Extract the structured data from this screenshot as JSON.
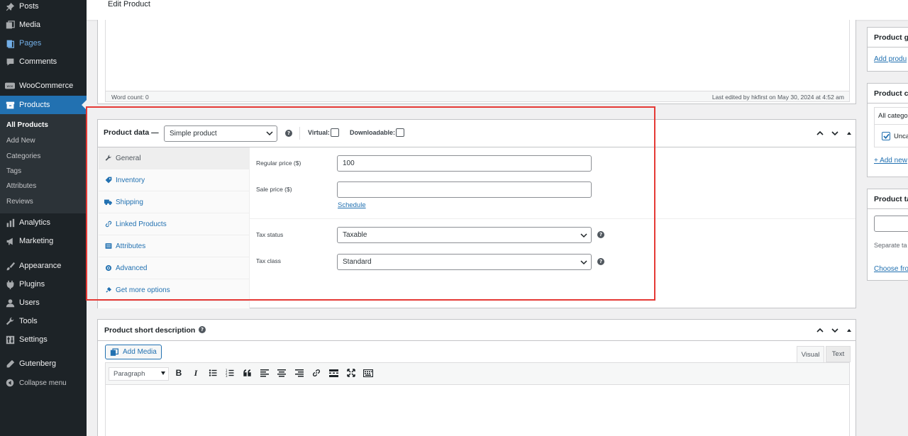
{
  "page": {
    "title": "Edit Product"
  },
  "sidebar": {
    "items": [
      {
        "label": "Posts",
        "icon": "pin-icon"
      },
      {
        "label": "Media",
        "icon": "media-icon"
      },
      {
        "label": "Pages",
        "icon": "pages-icon"
      },
      {
        "label": "Comments",
        "icon": "comment-icon"
      },
      {
        "label": "WooCommerce",
        "icon": "woo-icon"
      },
      {
        "label": "Products",
        "icon": "archive-icon"
      },
      {
        "label": "Analytics",
        "icon": "bar-chart-icon"
      },
      {
        "label": "Marketing",
        "icon": "megaphone-icon"
      },
      {
        "label": "Appearance",
        "icon": "brush-icon"
      },
      {
        "label": "Plugins",
        "icon": "plug-icon"
      },
      {
        "label": "Users",
        "icon": "user-icon"
      },
      {
        "label": "Tools",
        "icon": "wrench-icon"
      },
      {
        "label": "Settings",
        "icon": "settings-icon"
      },
      {
        "label": "Gutenberg",
        "icon": "pencil-icon"
      },
      {
        "label": "Collapse menu",
        "icon": "collapse-icon"
      }
    ],
    "submenu": [
      "All Products",
      "Add New",
      "Categories",
      "Tags",
      "Attributes",
      "Reviews"
    ]
  },
  "editor": {
    "word_count": "Word count: 0",
    "last_edited": "Last edited by hkfirst on May 30, 2024 at 4:52 am"
  },
  "product_data": {
    "title": "Product data —",
    "type_select": "Simple product",
    "virtual_label": "Virtual:",
    "downloadable_label": "Downloadable:",
    "virtual_checked": false,
    "downloadable_checked": false,
    "tabs": [
      "General",
      "Inventory",
      "Shipping",
      "Linked Products",
      "Attributes",
      "Advanced",
      "Get more options"
    ],
    "active_tab": "General",
    "regular_price_label": "Regular price ($)",
    "regular_price_value": "100",
    "sale_price_label": "Sale price ($)",
    "sale_price_value": "",
    "schedule_link": "Schedule",
    "tax_status_label": "Tax status",
    "tax_status_value": "Taxable",
    "tax_class_label": "Tax class",
    "tax_class_value": "Standard"
  },
  "short_description": {
    "title": "Product short description",
    "add_media": "Add Media",
    "tab_visual": "Visual",
    "tab_text": "Text",
    "format_select": "Paragraph"
  },
  "right_column": {
    "gallery_title": "Product g",
    "gallery_link": "Add produ",
    "categories_title": "Product ca",
    "categories_tab": "All catego",
    "category_item": "Unca",
    "add_new_category": "+ Add new",
    "tags_title": "Product ta",
    "tags_hint": "Separate ta",
    "tags_choose": "Choose fro"
  },
  "colors": {
    "sidebar": "#1d2327",
    "accent": "#2271b1",
    "highlight_outline": "#e53935"
  }
}
